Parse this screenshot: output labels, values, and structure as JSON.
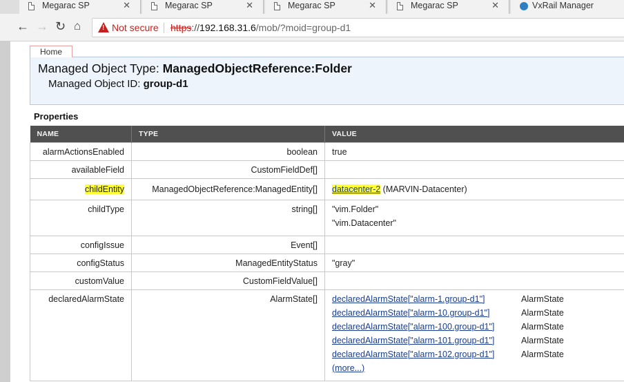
{
  "browser": {
    "tabs": [
      {
        "title": "Megarac SP",
        "icon": "document-icon"
      },
      {
        "title": "Megarac SP",
        "icon": "document-icon"
      },
      {
        "title": "Megarac SP",
        "icon": "document-icon"
      },
      {
        "title": "Megarac SP",
        "icon": "document-icon"
      },
      {
        "title": "VxRail Manager",
        "icon": "globe-icon"
      }
    ],
    "security_label": "Not secure",
    "url": {
      "scheme": "https",
      "rest": "://",
      "host": "192.168.31.6",
      "path": "/mob/?moid=group-d1"
    }
  },
  "page": {
    "home_label": "Home",
    "mo_type_label": "Managed Object Type: ",
    "mo_type_value": "ManagedObjectReference:Folder",
    "mo_id_label": "Managed Object ID: ",
    "mo_id_value": "group-d1",
    "properties_title": "Properties",
    "columns": {
      "name": "NAME",
      "type": "TYPE",
      "value": "VALUE"
    },
    "rows": {
      "alarmActionsEnabled": {
        "name": "alarmActionsEnabled",
        "type": "boolean",
        "value": "true"
      },
      "availableField": {
        "name": "availableField",
        "type": "CustomFieldDef[]",
        "value": ""
      },
      "childEntity": {
        "name": "childEntity",
        "type": "ManagedObjectReference:ManagedEntity[]",
        "link": "datacenter-2",
        "suffix": " (MARVIN-Datacenter)"
      },
      "childType": {
        "name": "childType",
        "type": "string[]",
        "values": [
          "\"vim.Folder\"",
          "\"vim.Datacenter\""
        ]
      },
      "configIssue": {
        "name": "configIssue",
        "type": "Event[]",
        "value": ""
      },
      "configStatus": {
        "name": "configStatus",
        "type": "ManagedEntityStatus",
        "value": "\"gray\""
      },
      "customValue": {
        "name": "customValue",
        "type": "CustomFieldValue[]",
        "value": ""
      },
      "declaredAlarmState": {
        "name": "declaredAlarmState",
        "type": "AlarmState[]",
        "items": [
          {
            "link": "declaredAlarmState[\"alarm-1.group-d1\"]",
            "type": "AlarmState"
          },
          {
            "link": "declaredAlarmState[\"alarm-10.group-d1\"]",
            "type": "AlarmState"
          },
          {
            "link": "declaredAlarmState[\"alarm-100.group-d1\"]",
            "type": "AlarmState"
          },
          {
            "link": "declaredAlarmState[\"alarm-101.group-d1\"]",
            "type": "AlarmState"
          },
          {
            "link": "declaredAlarmState[\"alarm-102.group-d1\"]",
            "type": "AlarmState"
          }
        ],
        "more_label": "(more...)"
      }
    }
  },
  "colors": {
    "highlight": "#ffff33",
    "header_bg": "#505050",
    "link": "#1a3d8f",
    "warning": "#c5221f"
  }
}
